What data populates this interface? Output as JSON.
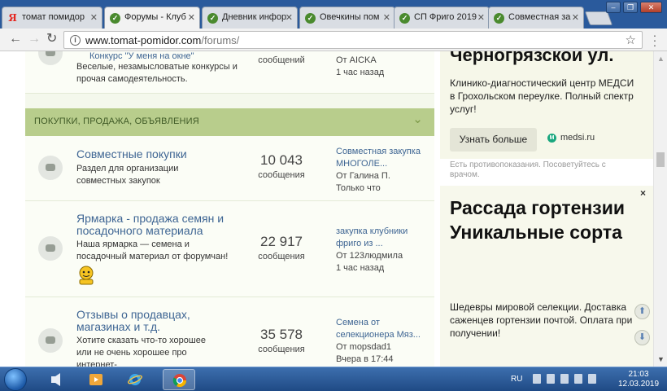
{
  "tabs": [
    {
      "label": "томат помидор",
      "favicon": "Я"
    },
    {
      "label": "Форумы - Клуб",
      "active": true
    },
    {
      "label": "Дневник инфор"
    },
    {
      "label": "Овечкины пом"
    },
    {
      "label": "СП Фриго 2019"
    },
    {
      "label": "Совместная за"
    }
  ],
  "address": {
    "host": "www.tomat-pomidor.com",
    "path": "/forums/"
  },
  "forum": {
    "top_row": {
      "title_fragment": "Конкурс \"У меня на окне\"",
      "desc": "Веселые, незамысловатые конкурсы и прочая самодеятельность.",
      "unit": "сообщений",
      "last_author": "От AICKA",
      "last_time": "1 час назад"
    },
    "category": "ПОКУПКИ, ПРОДАЖА, ОБЪЯВЛЕНИЯ",
    "rows": [
      {
        "title": "Совместные покупки",
        "desc": "Раздел для организации совместных закупок",
        "count": "10 043",
        "unit": "сообщения",
        "last_title": "Совместная закупка МНОГОЛЕ...",
        "last_author": "От Галина П.",
        "last_time": "Только что"
      },
      {
        "title": "Ярмарка - продажа семян и посадочного материала",
        "desc": "Наша ярмарка — семена и посадочный материал от форумчан!",
        "count": "22 917",
        "unit": "сообщения",
        "last_title": "закупка клубники фриго из ...",
        "last_author": "От 123людмила",
        "last_time": "1 час назад"
      },
      {
        "title": "Отзывы о продавцах, магазинах и т.д.",
        "desc": "Хотите сказать что-то хорошее или не очень хорошее про интернет-",
        "count": "35 578",
        "unit": "сообщения",
        "last_title": "Семена от селекционера Мяз...",
        "last_author": "От mopsdad1",
        "last_time": "Вчера в 17:44"
      }
    ]
  },
  "ads": {
    "ad1": {
      "headline": "Черногрязской ул.",
      "text": "Клинико-диагностический центр МЕДСИ в Грохольском переулке. Полный спектр услуг!",
      "button": "Узнать больше",
      "domain": "medsi.ru",
      "note": "Есть противопоказания. Посоветуйтесь с врачом."
    },
    "ad2": {
      "headline": "Рассада гортензии Уникальные сорта",
      "text": "Шедевры мировой селекции. Доставка саженцев гортензии почтой. Оплата при получении!",
      "close": "×"
    }
  },
  "taskbar": {
    "lang": "RU",
    "time": "21:03",
    "date": "12.03.2019"
  }
}
